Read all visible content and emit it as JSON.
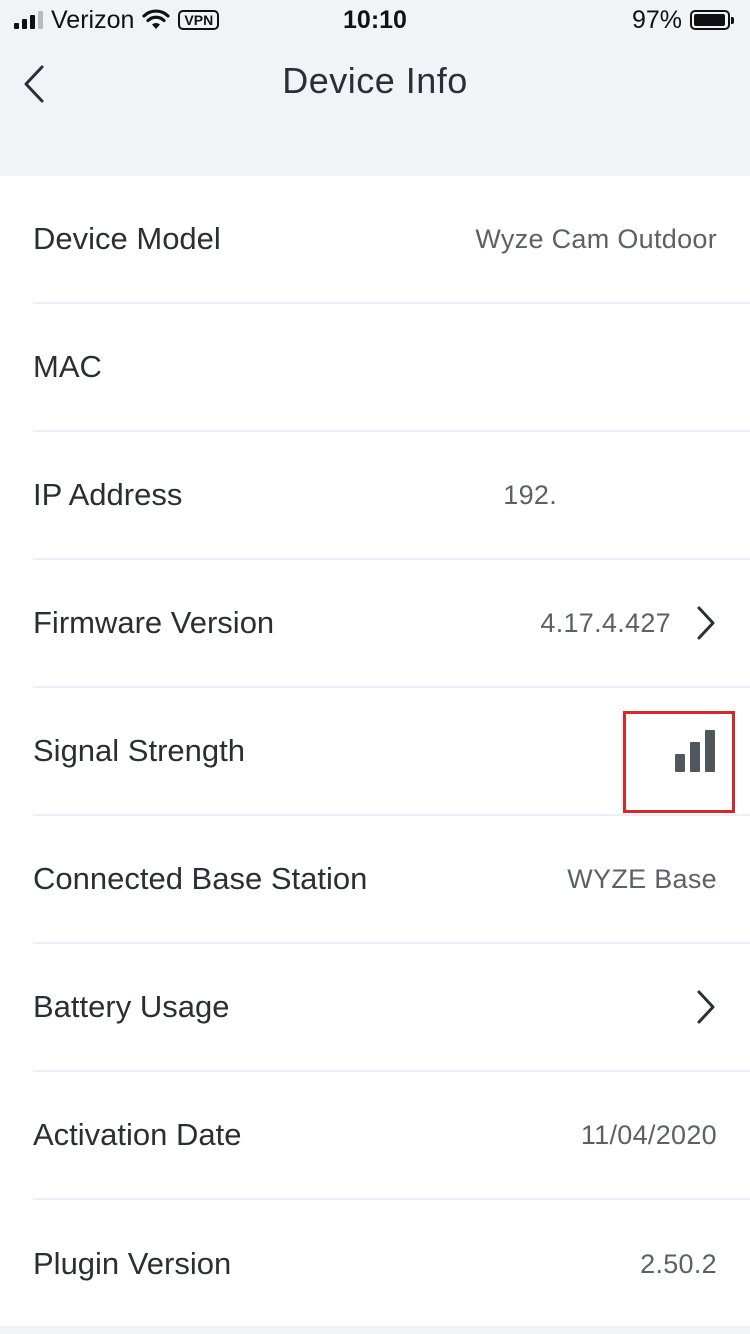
{
  "status_bar": {
    "carrier": "Verizon",
    "vpn": "VPN",
    "time": "10:10",
    "battery": "97%",
    "battery_level": 0.97
  },
  "nav": {
    "title": "Device Info",
    "back_icon": "chevron-left-icon"
  },
  "rows": [
    {
      "label": "Device Model",
      "value": "Wyze Cam Outdoor"
    },
    {
      "label": "MAC",
      "value": ""
    },
    {
      "label": "IP Address",
      "value": "192."
    },
    {
      "label": "Firmware Version",
      "value": "4.17.4.427",
      "chevron": true
    },
    {
      "label": "Signal Strength",
      "icon": "signal-strength-icon",
      "signal_level": 3,
      "highlighted": true
    },
    {
      "label": "Connected Base Station",
      "value": "WYZE Base"
    },
    {
      "label": "Battery Usage",
      "value": "",
      "chevron": true
    },
    {
      "label": "Activation Date",
      "value": "11/04/2020"
    },
    {
      "label": "Plugin Version",
      "value": "2.50.2"
    }
  ],
  "colors": {
    "highlight": "#d9262d",
    "background": "#f1f4f7",
    "text": "#2b2f33",
    "value_text": "#5b6167"
  }
}
